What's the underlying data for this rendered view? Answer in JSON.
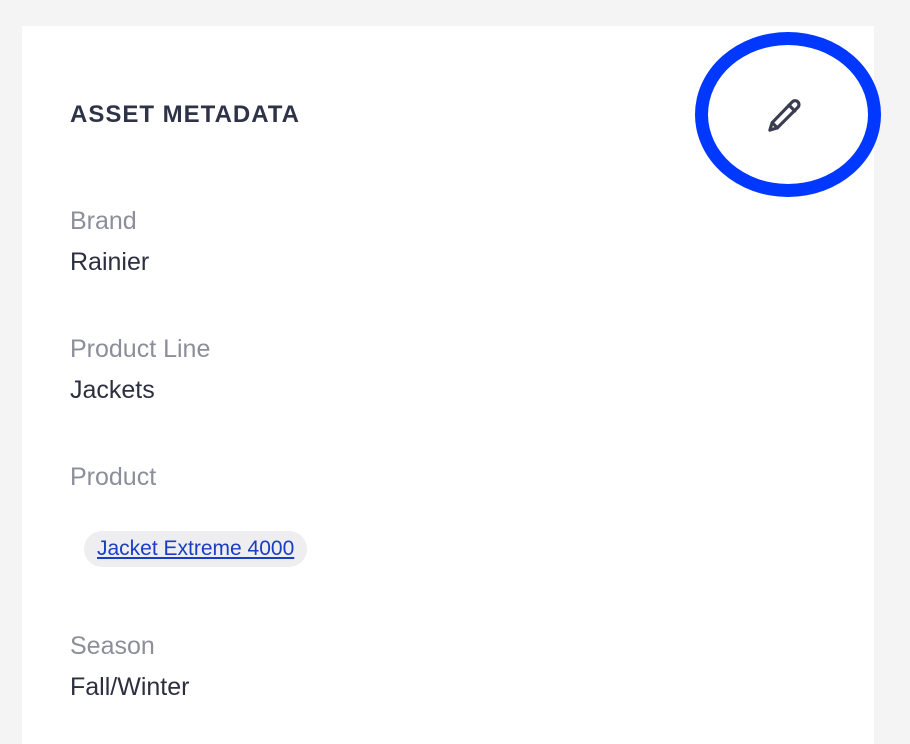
{
  "panel": {
    "title": "ASSET METADATA",
    "edit_icon": "pencil-icon",
    "highlight_color": "#0038ff"
  },
  "fields": {
    "brand": {
      "label": "Brand",
      "value": "Rainier"
    },
    "product_line": {
      "label": "Product Line",
      "value": "Jackets"
    },
    "product": {
      "label": "Product",
      "tags": [
        "Jacket Extreme 4000"
      ]
    },
    "season": {
      "label": "Season",
      "value": "Fall/Winter"
    }
  }
}
